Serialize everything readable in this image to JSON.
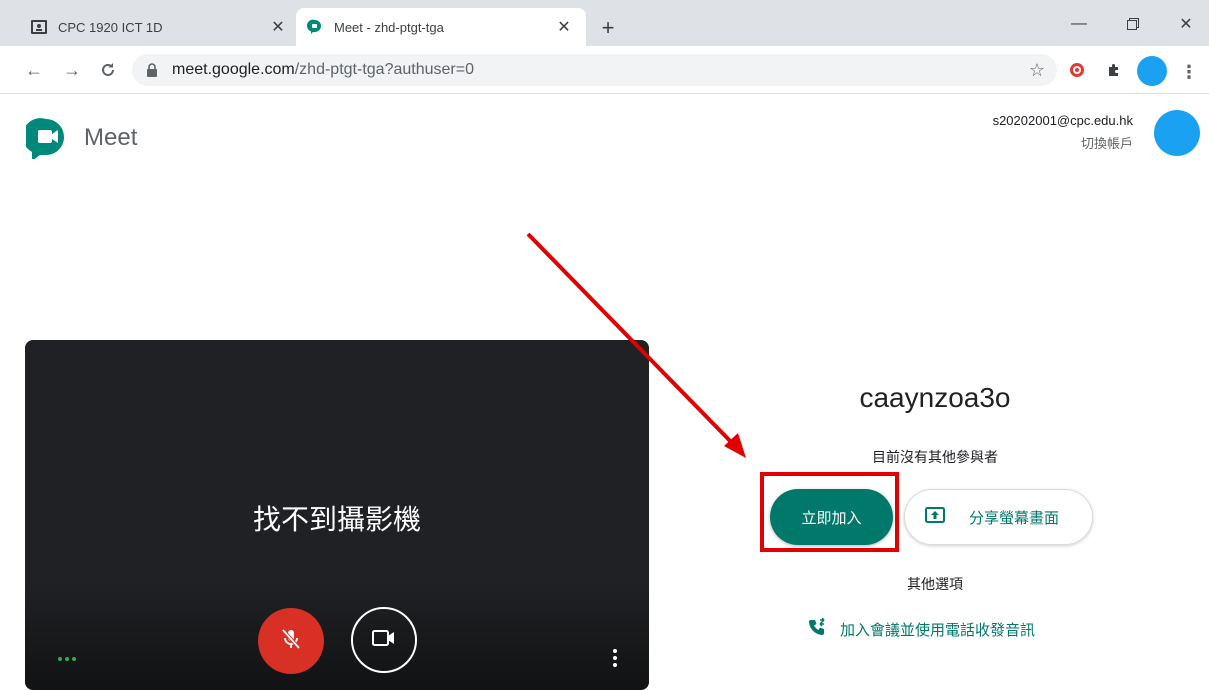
{
  "browser": {
    "tabs": [
      {
        "title": "CPC 1920 ICT 1D",
        "active": false,
        "icon": "classroom-icon"
      },
      {
        "title": "Meet - zhd-ptgt-tga",
        "active": true,
        "icon": "meet-icon"
      }
    ],
    "new_tab_label": "+",
    "address": {
      "host": "meet.google.com",
      "path": "/zhd-ptgt-tga?authuser=0"
    }
  },
  "header": {
    "brand": "Meet",
    "account_email": "s20202001@cpc.edu.hk",
    "switch_account": "切換帳戶"
  },
  "preview": {
    "no_camera_text": "找不到攝影機",
    "mic_state": "muted"
  },
  "join": {
    "meeting_code": "caaynzoa3o",
    "participants_status": "目前沒有其他參與者",
    "join_now": "立即加入",
    "present": "分享螢幕畫面",
    "other_options": "其他選項",
    "join_by_phone": "加入會議並使用電話收發音訊"
  },
  "colors": {
    "accent": "#00796b",
    "mic_muted": "#d93025",
    "annotation": "#e00000",
    "avatar": "#1ba1f2"
  }
}
